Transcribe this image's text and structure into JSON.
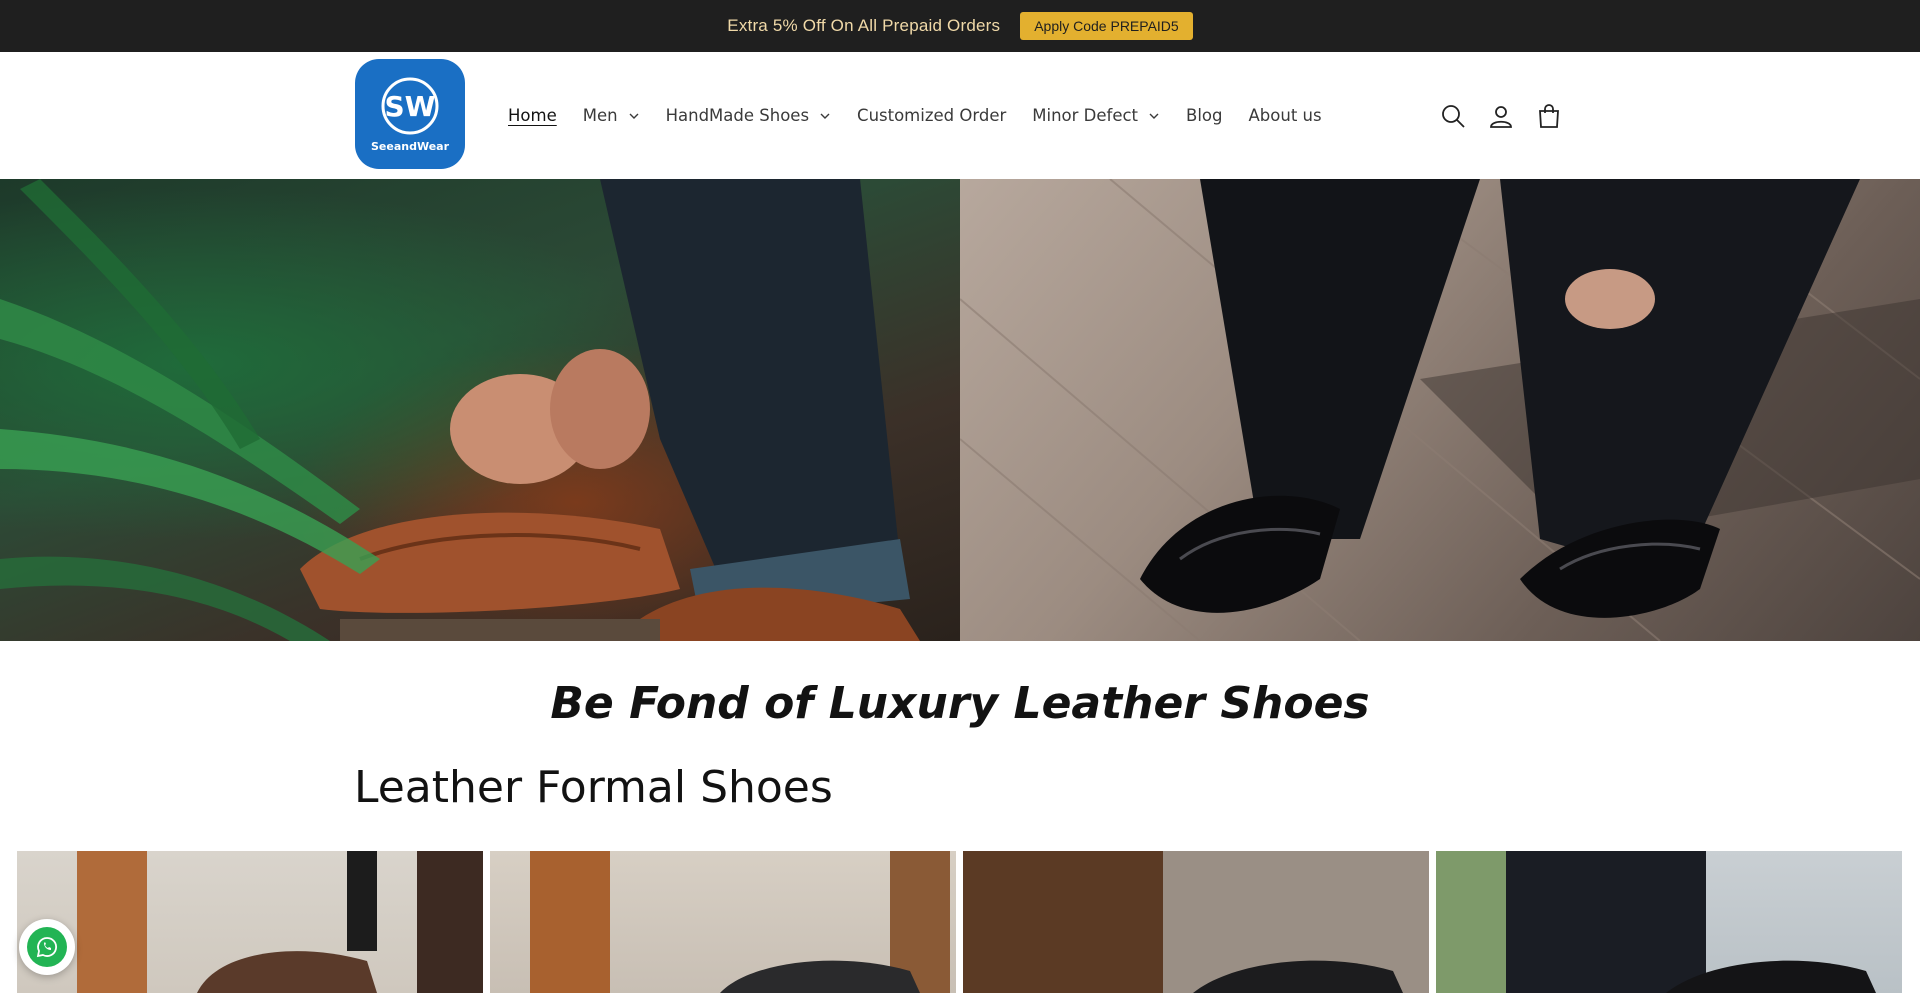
{
  "announcement": {
    "text": "Extra 5% Off On All Prepaid Orders",
    "button_label": "Apply Code PREPAID5",
    "bar_color": "#1f1f1f",
    "button_color": "#e3b02f"
  },
  "header": {
    "logo_text": "SeeandWear",
    "logo_color": "#1a6fc4",
    "nav": [
      {
        "label": "Home",
        "active": true
      },
      {
        "label": "Men",
        "dropdown": true
      },
      {
        "label": "HandMade Shoes",
        "dropdown": true
      },
      {
        "label": "Customized Order"
      },
      {
        "label": "Minor Defect",
        "dropdown": true
      },
      {
        "label": "Blog"
      },
      {
        "label": "About us"
      }
    ],
    "icons": [
      "search-icon",
      "account-icon",
      "cart-icon"
    ]
  },
  "hero": {
    "panels": [
      "hero-image-brown-brogues",
      "hero-image-black-oxfords"
    ]
  },
  "headline": "Be Fond of Luxury Leather Shoes",
  "collection": {
    "title": "Leather Formal Shoes",
    "products": [
      "product-card-1",
      "product-card-2",
      "product-card-3",
      "product-card-4"
    ]
  },
  "whatsapp": {
    "icon": "whatsapp-icon",
    "color": "#22b454"
  }
}
